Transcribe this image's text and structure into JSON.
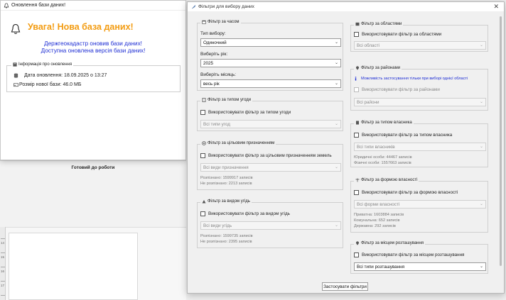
{
  "update_window": {
    "title": "Оновлення бази даних!",
    "heading": "Увага! Нова база даних!",
    "message_line1": "Держгеокадастр оновив бази даних!",
    "message_line2": "Доступна оновлена версія бази даних!",
    "info_group_title": "Інформація про оновлення",
    "update_date": "Дата оновлення: 18.09.2025 о 13:27",
    "db_size": "Розмір нової бази: 46.0 МБ",
    "colors": {
      "heading": "#f39c12",
      "message": "#1f2fd4"
    }
  },
  "background_app": {
    "status": "Готовий до роботи",
    "ruler_marks": [
      "14",
      "15",
      "16",
      "17"
    ]
  },
  "filter_dialog": {
    "title": "Фільтри для вибору даних",
    "apply_button": "Застосувати фільтри",
    "year_group": {
      "title": "Фільтр за часом",
      "type_label": "Тип вибору:",
      "type_value": "Одиночний",
      "year_label": "Виберіть рік:",
      "year_value": "2025",
      "month_label": "Виберіть місяць:",
      "month_value": "весь рік"
    },
    "deal_group": {
      "title": "Фільтр за типом угоди",
      "checkbox": "Використовувати фільтр за типом угоди",
      "combo": "Всі типи угод"
    },
    "purpose_group": {
      "title": "Фільтр за цільовим призначенням",
      "checkbox": "Використовувати фільтр за цільовим призначенням земель",
      "combo": "Всі види призначення",
      "recognized": "Розпізнано: 1599917 записів",
      "unrecognized": "Не розпізнано: 2213 записів"
    },
    "land_type_group": {
      "title": "Фільтр за видом угідь",
      "checkbox": "Використовувати фільтр за видом угідь",
      "combo": "Всі види угідь",
      "recognized": "Розпізнано: 1599735 записів",
      "unrecognized": "Не розпізнано: 2395 записів"
    },
    "region_group": {
      "title": "Фільтр за областями",
      "checkbox": "Використовувати фільтр за областями",
      "combo": "Всі області"
    },
    "district_group": {
      "title": "Фільтр за районами",
      "note": "Можливість застосування тільки при виборі однієї області",
      "checkbox": "Використовувати фільтр за районами",
      "combo": "Всі райони"
    },
    "owner_type_group": {
      "title": "Фільтр за типом власника",
      "checkbox": "Використовувати фільтр за типом власника",
      "combo": "Всі типи власників",
      "legal": "Юридичні особи: 44467 записів",
      "individual": "Фізичні особи: 1557663 записів"
    },
    "ownership_group": {
      "title": "Фільтр за формою власності",
      "checkbox": "Використовувати фільтр за формою власності",
      "combo": "Всі форми власності",
      "private": "Приватна: 1603884 записів",
      "communal": "Комунальна: 652 записів",
      "state": "Державна: 292 записів"
    },
    "location_group": {
      "title": "Фільтр за місцем розташування",
      "checkbox": "Використовувати фільтр за місцем розташування",
      "combo": "Всі типи розташування"
    }
  }
}
